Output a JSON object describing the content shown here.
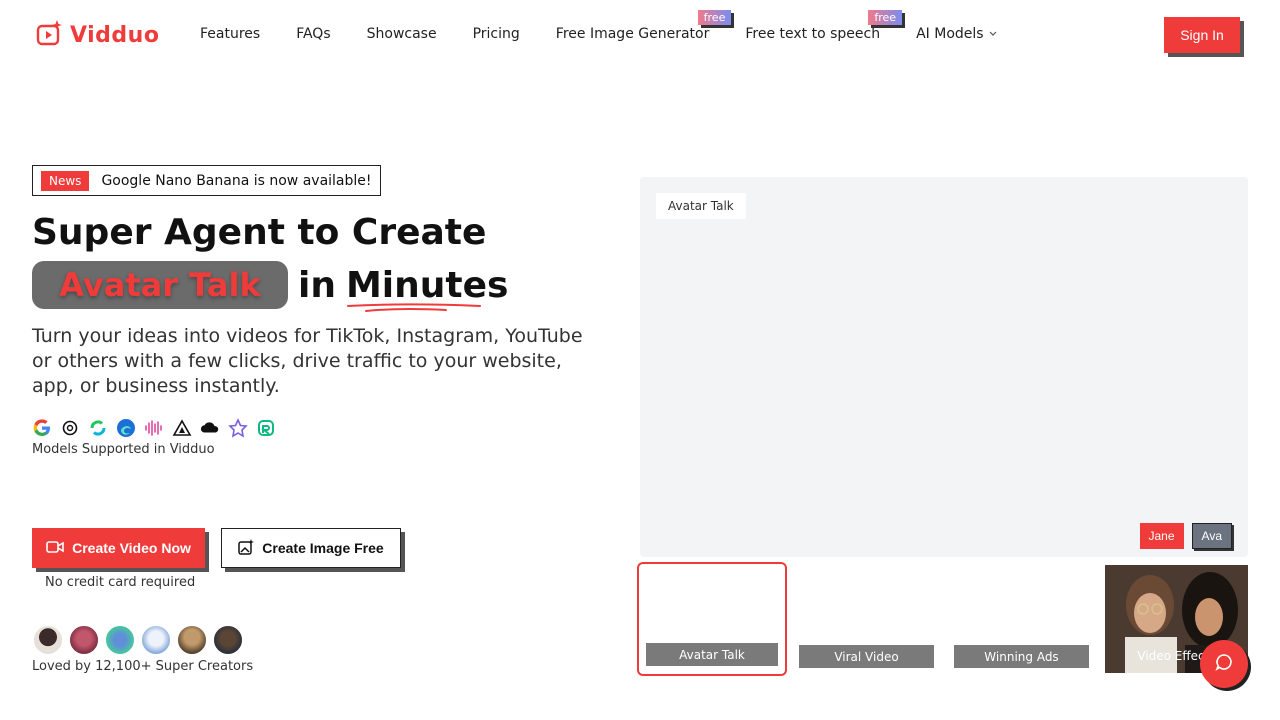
{
  "brand": {
    "name": "Vidduo",
    "accent": "#f03b3b"
  },
  "nav": {
    "items": [
      {
        "label": "Features"
      },
      {
        "label": "FAQs"
      },
      {
        "label": "Showcase"
      },
      {
        "label": "Pricing"
      },
      {
        "label": "Free Image Generator",
        "badge": "free"
      },
      {
        "label": "Free text to speech",
        "badge": "free"
      },
      {
        "label": "AI Models"
      }
    ],
    "sign_in": "Sign In"
  },
  "hero": {
    "news_tag": "News",
    "news_text": "Google Nano Banana is now available!",
    "headline_line1": "Super Agent to Create",
    "headline_pill": "Avatar Talk",
    "headline_in": "in",
    "headline_minutes": "Minutes",
    "subtitle": "Turn your ideas into videos for TikTok, Instagram, YouTube or others with a few clicks, drive traffic to your website, app, or business instantly.",
    "models_caption": "Models Supported in Vidduo",
    "model_icons": [
      "google-icon",
      "openai-icon",
      "kling-icon",
      "edge-icon",
      "audio-wave-icon",
      "triangle-icon",
      "cloud-icon",
      "star-icon",
      "runway-icon"
    ],
    "create_video": "Create Video Now",
    "create_image": "Create Image Free",
    "no_credit": "No credit card required",
    "loved": "Loved by 12,100+ Super Creators"
  },
  "preview": {
    "tag": "Avatar Talk",
    "persons": [
      "Jane",
      "Ava"
    ],
    "thumbnails": [
      {
        "label": "Avatar Talk"
      },
      {
        "label": "Viral Video"
      },
      {
        "label": "Winning Ads"
      },
      {
        "label": "Video Effects"
      }
    ]
  }
}
